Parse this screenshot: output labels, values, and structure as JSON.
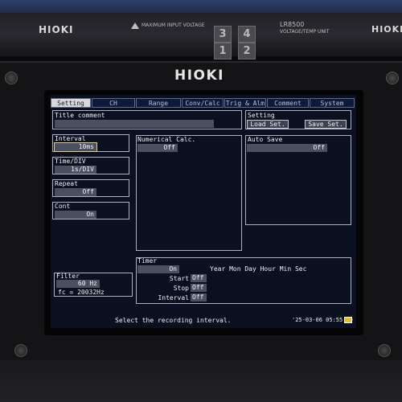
{
  "device": {
    "top_brand": "HIOKI",
    "top_right_brand": "HIOKI",
    "warning_text": "MAXIMUM INPUT VOLTAGE",
    "module_model": "LR8500",
    "module_desc": "VOLTAGE/TEMP UNIT",
    "keys": [
      "3",
      "4",
      "1",
      "2"
    ],
    "main_brand": "HIOKI"
  },
  "screen": {
    "tabs": [
      {
        "label": "Setting",
        "active": true
      },
      {
        "label": "CH",
        "active": false
      },
      {
        "label": "Range",
        "active": false
      },
      {
        "label": "Conv/Calc",
        "active": false
      },
      {
        "label": "Trig & Alm",
        "active": false
      },
      {
        "label": "Comment",
        "active": false
      },
      {
        "label": "System",
        "active": false
      }
    ],
    "title_comment": {
      "label": "Title comment",
      "value": ""
    },
    "setting": {
      "label": "Setting",
      "load_label": "Load Set.",
      "save_label": "Save Set."
    },
    "interval": {
      "label": "Interval",
      "value": "10ms"
    },
    "time_div": {
      "label": "Time/DIV",
      "value": "1s/DIV"
    },
    "repeat": {
      "label": "Repeat",
      "value": "Off"
    },
    "cont": {
      "label": "Cont",
      "value": "On"
    },
    "numerical_calc": {
      "label": "Numerical Calc.",
      "value": "Off"
    },
    "auto_save": {
      "label": "Auto Save",
      "value": "Off"
    },
    "filter": {
      "label": "Filter",
      "value": "60 Hz",
      "fc": "fc = 20032Hz"
    },
    "timer": {
      "label": "Timer",
      "value": "On",
      "columns": "Year Mon Day Hour Min Sec",
      "start_label": "Start",
      "start_value": "Off",
      "stop_label": "Stop",
      "stop_value": "Off",
      "interval_label": "Interval",
      "interval_value": "Off"
    },
    "status_message": "Select the recording interval.",
    "datetime": "'25-03-06 05:55:09"
  },
  "colors": {
    "screen_bg": "#0a1020",
    "selected_outline": "#e8d060",
    "battery": "#e8c020"
  }
}
